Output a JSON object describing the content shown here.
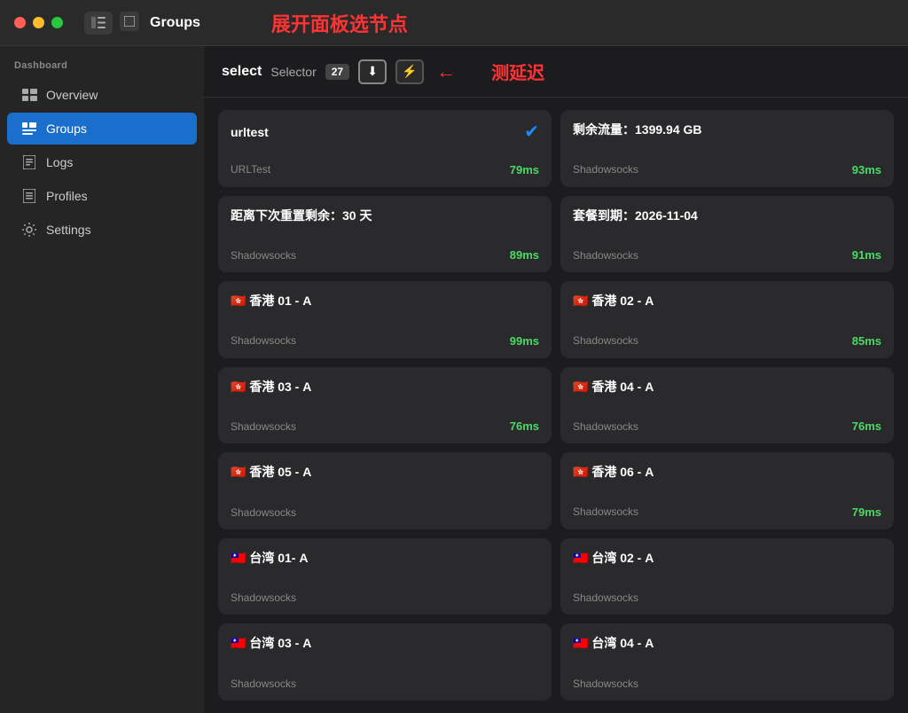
{
  "titlebar": {
    "title": "Groups",
    "annotation": "展开面板选节点"
  },
  "sidebar": {
    "dashboard_label": "Dashboard",
    "items": [
      {
        "id": "overview",
        "label": "Overview",
        "icon": "⊞",
        "active": false
      },
      {
        "id": "groups",
        "label": "Groups",
        "icon": "⊟",
        "active": true
      },
      {
        "id": "logs",
        "label": "Logs",
        "icon": "📄",
        "active": false
      },
      {
        "id": "profiles",
        "label": "Profiles",
        "icon": "📋",
        "active": false
      },
      {
        "id": "settings",
        "label": "Settings",
        "icon": "⚙",
        "active": false
      }
    ]
  },
  "toolbar": {
    "select_label": "select",
    "selector_label": "Selector",
    "badge_count": "27",
    "download_icon": "⬇",
    "speed_icon": "⚡",
    "annotation_delay": "测延迟"
  },
  "cards": [
    {
      "id": "urltest",
      "title": "urltest",
      "subtitle": "URLTest",
      "latency": "79ms",
      "has_check": true,
      "flag": ""
    },
    {
      "id": "remaining-traffic",
      "title": "剩余流量：1399.94 GB",
      "subtitle": "Shadowsocks",
      "latency": "93ms",
      "has_check": false,
      "flag": ""
    },
    {
      "id": "reset-days",
      "title": "距离下次重置剩余：30 天",
      "subtitle": "Shadowsocks",
      "latency": "89ms",
      "has_check": false,
      "flag": ""
    },
    {
      "id": "expire-date",
      "title": "套餐到期：2026-11-04",
      "subtitle": "Shadowsocks",
      "latency": "91ms",
      "has_check": false,
      "flag": ""
    },
    {
      "id": "hk01a",
      "title": "🇭🇰 香港 01 - A",
      "subtitle": "Shadowsocks",
      "latency": "99ms",
      "has_check": false,
      "flag": "hk"
    },
    {
      "id": "hk02a",
      "title": "🇭🇰 香港 02 - A",
      "subtitle": "Shadowsocks",
      "latency": "85ms",
      "has_check": false,
      "flag": "hk"
    },
    {
      "id": "hk03a",
      "title": "🇭🇰 香港 03 - A",
      "subtitle": "Shadowsocks",
      "latency": "76ms",
      "has_check": false,
      "flag": "hk"
    },
    {
      "id": "hk04a",
      "title": "🇭🇰 香港 04 - A",
      "subtitle": "Shadowsocks",
      "latency": "76ms",
      "has_check": false,
      "flag": "hk"
    },
    {
      "id": "hk05a",
      "title": "🇭🇰 香港 05 - A",
      "subtitle": "Shadowsocks",
      "latency": "",
      "has_check": false,
      "flag": "hk"
    },
    {
      "id": "hk06a",
      "title": "🇭🇰 香港 06 - A",
      "subtitle": "Shadowsocks",
      "latency": "79ms",
      "has_check": false,
      "flag": "hk"
    },
    {
      "id": "tw01a",
      "title": "🇹🇼 台湾 01- A",
      "subtitle": "Shadowsocks",
      "latency": "",
      "has_check": false,
      "flag": "tw"
    },
    {
      "id": "tw02a",
      "title": "🇹🇼 台湾 02 - A",
      "subtitle": "Shadowsocks",
      "latency": "",
      "has_check": false,
      "flag": "tw"
    },
    {
      "id": "tw03a",
      "title": "🇹🇼 台湾 03 - A",
      "subtitle": "Shadowsocks",
      "latency": "",
      "has_check": false,
      "flag": "tw"
    },
    {
      "id": "tw04a",
      "title": "🇹🇼 台湾 04 - A",
      "subtitle": "Shadowsocks",
      "latency": "",
      "has_check": false,
      "flag": "tw"
    }
  ]
}
